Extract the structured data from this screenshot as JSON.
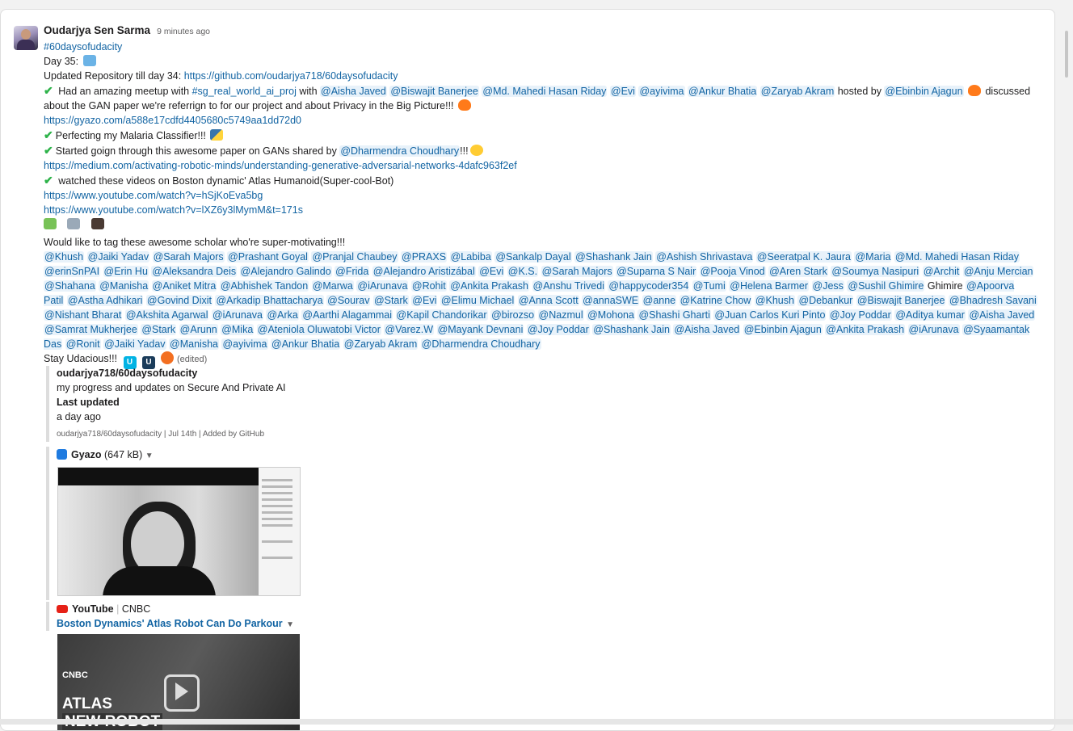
{
  "post": {
    "author": "Oudarjya Sen Sarma",
    "time": "9 minutes ago",
    "hashtag": "#60daysofudacity",
    "day": "Day 35:",
    "repo_prefix": "Updated Repository till day 34: ",
    "repo_link": "https://github.com/oudarjya718/60daysofudacity",
    "meetup_1": "Had an amazing meetup with ",
    "meetup_channel": "#sg_real_world_ai_proj",
    "meetup_2": " with ",
    "meetup_mentions": [
      "@Aisha Javed",
      "@Biswajit Banerjee",
      "@Md. Mahedi Hasan Riday",
      "@Evi",
      "@ayivima",
      "@Ankur Bhatia",
      "@Zaryab Akram"
    ],
    "meetup_3": " hosted by ",
    "meetup_host": "@Ebinbin Ajagun",
    "meetup_4": " discussed about the GAN paper we're referrign to for our project and about Privacy in the Big Picture!!!",
    "gyazo_link": "https://gyazo.com/a588e17cdfd4405680c5749aa1dd72d0",
    "malaria": "Perfecting my Malaria Classifier!!!",
    "gan_1": "Started goign through this awesome paper on GANs shared by ",
    "gan_mention": "@Dharmendra Choudhary",
    "gan_2": "!!!",
    "medium_link": "https://medium.com/activating-robotic-minds/understanding-generative-adversarial-networks-4dafc963f2ef",
    "videos": "watched these videos on Boston dynamic' Atlas Humanoid(Super-cool-Bot)",
    "yt_link_1": "https://www.youtube.com/watch?v=hSjKoEva5bg",
    "yt_link_2": "https://www.youtube.com/watch?v=lXZ6y3lMymM&t=171s",
    "tag_intro": "Would like to tag these awesome scholar who're super-motivating!!!",
    "tags": [
      "@Khush",
      "@Jaiki Yadav",
      "@Sarah Majors",
      "@Prashant Goyal",
      "@Pranjal Chaubey",
      "@PRAXS",
      "@Labiba",
      "@Sankalp Dayal",
      "@Shashank Jain",
      "@Ashish Shrivastava",
      "@Seeratpal K. Jaura",
      "@Maria",
      "@Md. Mahedi Hasan Riday",
      "@erinSnPAI",
      "@Erin Hu",
      "@Aleksandra Deis",
      "@Alejandro Galindo",
      "@Frida",
      "@Alejandro Aristizábal",
      "@Evi",
      "@K.S.",
      "@Sarah Majors",
      "@Suparna S Nair",
      "@Pooja Vinod",
      "@Aren Stark",
      "@Soumya Nasipuri",
      "@Archit",
      "@Anju Mercian",
      "@Shahana",
      "@Manisha",
      "@Aniket Mitra",
      "@Abhishek Tandon",
      "@Marwa",
      "@iArunava",
      "@Rohit",
      "@Ankita Prakash",
      "@Anshu Trivedi",
      "@happycoder354",
      "@Tumi",
      "@Helena Barmer",
      "@Jess",
      "@Sushil Ghimire",
      "Ghimire",
      "@Apoorva Patil",
      "@Astha Adhikari",
      "@Govind Dixit",
      "@Arkadip Bhattacharya",
      "@Sourav",
      "@Stark",
      "@Evi",
      "@Elimu Michael",
      "@Anna Scott",
      "@annaSWE",
      "@anne",
      "@Katrine Chow",
      "@Khush",
      "@Debankur",
      "@Biswajit Banerjee",
      "@Bhadresh Savani",
      "@Nishant Bharat",
      "@Akshita Agarwal",
      "@iArunava",
      "@Arka",
      "@Aarthi Alagammai",
      "@Kapil Chandorikar",
      "@birozso",
      "@Nazmul",
      "@Mohona",
      "@Shashi Gharti",
      "@Juan Carlos Kuri Pinto",
      "@Joy Poddar",
      "@Aditya kumar",
      "@Aisha Javed",
      "@Samrat Mukherjee",
      "@Stark",
      "@Arunn",
      "@Mika",
      "@Ateniola Oluwatobi Victor",
      "@Varez.W",
      "@Mayank Devnani",
      "@Joy Poddar",
      "@Shashank Jain",
      "@Aisha Javed",
      "@Ebinbin Ajagun",
      "@Ankita Prakash",
      "@iArunava",
      "@Syaamantak Das",
      "@Ronit",
      "@Jaiki Yadav",
      "@Manisha",
      "@ayivima",
      "@Ankur Bhatia",
      "@Zaryab Akram",
      "@Dharmendra Choudhary"
    ],
    "stay": "Stay Udacious!!!",
    "edited": "(edited)"
  },
  "github_attachment": {
    "title": "oudarjya718/60daysofudacity",
    "desc": "my progress and updates on Secure And Private AI",
    "field_label": "Last updated",
    "field_value": "a day ago",
    "footer": "oudarjya718/60daysofudacity | Jul 14th | Added by GitHub"
  },
  "gyazo_attachment": {
    "source": "Gyazo",
    "size": "(647 kB)"
  },
  "youtube_attachment": {
    "source": "YouTube",
    "channel": "CNBC",
    "title": "Boston Dynamics' Atlas Robot Can Do Parkour",
    "thumb_brand": "CNBC",
    "thumb_line1": "ATLAS",
    "thumb_line2": "NEW ROBOT"
  },
  "colors": {
    "link": "#1264a3",
    "mention_bg": "#e8f2fa",
    "check": "#2eb34a"
  }
}
